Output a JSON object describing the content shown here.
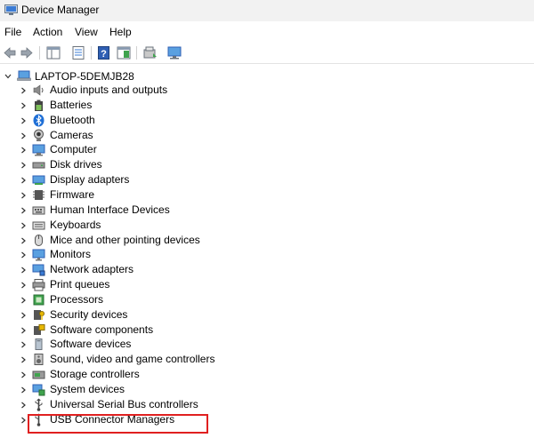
{
  "window": {
    "title": "Device Manager"
  },
  "menu": [
    "File",
    "Action",
    "View",
    "Help"
  ],
  "toolbar": {
    "buttons": [
      "back-icon",
      "forward-icon",
      "show-hide-tree-icon",
      "properties-icon",
      "help-icon",
      "action-pane-icon",
      "update-driver-icon",
      "scan-hardware-icon"
    ]
  },
  "tree": {
    "root": "LAPTOP-5DEMJB28",
    "items": [
      {
        "label": "Audio inputs and outputs",
        "icon": "speaker-icon"
      },
      {
        "label": "Batteries",
        "icon": "battery-icon"
      },
      {
        "label": "Bluetooth",
        "icon": "bluetooth-icon"
      },
      {
        "label": "Cameras",
        "icon": "camera-icon"
      },
      {
        "label": "Computer",
        "icon": "computer-icon"
      },
      {
        "label": "Disk drives",
        "icon": "disk-drive-icon"
      },
      {
        "label": "Display adapters",
        "icon": "display-adapter-icon"
      },
      {
        "label": "Firmware",
        "icon": "firmware-icon"
      },
      {
        "label": "Human Interface Devices",
        "icon": "hid-icon"
      },
      {
        "label": "Keyboards",
        "icon": "keyboard-icon"
      },
      {
        "label": "Mice and other pointing devices",
        "icon": "mouse-icon"
      },
      {
        "label": "Monitors",
        "icon": "monitor-icon"
      },
      {
        "label": "Network adapters",
        "icon": "network-adapter-icon"
      },
      {
        "label": "Print queues",
        "icon": "printer-icon"
      },
      {
        "label": "Processors",
        "icon": "processor-icon"
      },
      {
        "label": "Security devices",
        "icon": "security-device-icon"
      },
      {
        "label": "Software components",
        "icon": "software-component-icon"
      },
      {
        "label": "Software devices",
        "icon": "software-device-icon"
      },
      {
        "label": "Sound, video and game controllers",
        "icon": "sound-controller-icon"
      },
      {
        "label": "Storage controllers",
        "icon": "storage-controller-icon"
      },
      {
        "label": "System devices",
        "icon": "system-device-icon"
      },
      {
        "label": "Universal Serial Bus controllers",
        "icon": "usb-icon"
      },
      {
        "label": "USB Connector Managers",
        "icon": "usb-connector-icon"
      }
    ]
  },
  "highlighted_item": "Sound, video and game controllers",
  "colors": {
    "highlight_border": "#e02020",
    "titlebar_bg": "#f2f2f2"
  }
}
